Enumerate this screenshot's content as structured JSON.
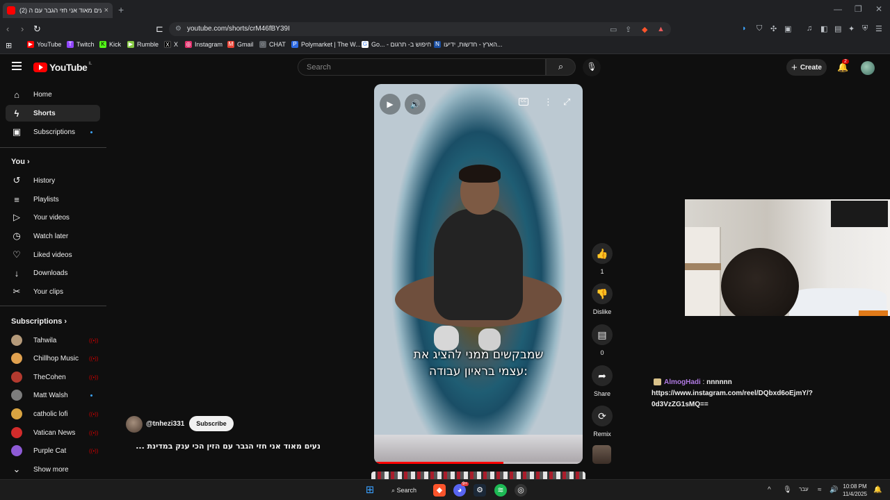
{
  "browser": {
    "tab_title": "(2) נעים מאוד אני חזי הגבר עם ה",
    "tab_close": "×",
    "new_tab": "+",
    "url": "youtube.com/shorts/crM46fBY39I",
    "bookmarks": [
      {
        "label": "YouTube",
        "color": "#ff0000",
        "glyph": "▶"
      },
      {
        "label": "Twitch",
        "color": "#9146ff",
        "glyph": "T"
      },
      {
        "label": "Kick",
        "color": "#53fc18",
        "glyph": "K"
      },
      {
        "label": "Rumble",
        "color": "#85c742",
        "glyph": "▶"
      },
      {
        "label": "X",
        "color": "#000000",
        "glyph": "X"
      },
      {
        "label": "Instagram",
        "color": "#e1306c",
        "glyph": "◎"
      },
      {
        "label": "Gmail",
        "color": "#ea4335",
        "glyph": "M"
      },
      {
        "label": "CHAT",
        "color": "#5f6368",
        "glyph": "◌"
      },
      {
        "label": "Polymarket | The W...",
        "color": "#2d6ae3",
        "glyph": "P"
      },
      {
        "label": "Go... - חיפוש ב- תרגום",
        "color": "#ffffff",
        "glyph": "G"
      },
      {
        "label": "הארץ - חדשות, ידיעו...",
        "color": "#1a4fa3",
        "glyph": "N"
      }
    ]
  },
  "youtube": {
    "logo_text": "YouTube",
    "logo_country": "IL",
    "search_placeholder": "Search",
    "create_label": "Create",
    "notif_count": "2"
  },
  "sidebar": {
    "main": [
      {
        "label": "Home",
        "icon": "home-icon",
        "glyph": "⌂"
      },
      {
        "label": "Shorts",
        "icon": "shorts-icon",
        "glyph": "ϟ"
      },
      {
        "label": "Subscriptions",
        "icon": "subscriptions-icon",
        "glyph": "▣"
      }
    ],
    "you_heading": "You",
    "you_items": [
      {
        "label": "History",
        "icon": "history-icon",
        "glyph": "↺"
      },
      {
        "label": "Playlists",
        "icon": "playlists-icon",
        "glyph": "≡"
      },
      {
        "label": "Your videos",
        "icon": "your-videos-icon",
        "glyph": "▷"
      },
      {
        "label": "Watch later",
        "icon": "watch-later-icon",
        "glyph": "◷"
      },
      {
        "label": "Liked videos",
        "icon": "liked-videos-icon",
        "glyph": "👍"
      },
      {
        "label": "Downloads",
        "icon": "downloads-icon",
        "glyph": "↓"
      },
      {
        "label": "Your clips",
        "icon": "clips-icon",
        "glyph": "✂"
      }
    ],
    "subs_heading": "Subscriptions",
    "subscriptions": [
      {
        "label": "Tahwila",
        "color": "#b59a7a",
        "status": "live"
      },
      {
        "label": "Chillhop Music",
        "color": "#e0a14f",
        "status": "live"
      },
      {
        "label": "TheCohen",
        "color": "#b33a2f",
        "status": "live"
      },
      {
        "label": "Matt Walsh",
        "color": "#7d7d7d",
        "status": "dot"
      },
      {
        "label": "catholic lofi",
        "color": "#d9a441",
        "status": "live"
      },
      {
        "label": "Vatican News",
        "color": "#d22b2b",
        "status": "live"
      },
      {
        "label": "Purple Cat",
        "color": "#8e5bd6",
        "status": "live"
      }
    ],
    "show_more": "Show more"
  },
  "player": {
    "caption_line1": "שמבקשים ממני להציג את",
    "caption_line2": "עצמי בראיון עבודה:",
    "progress": 0.62
  },
  "actions": {
    "like_count": "1",
    "dislike_label": "Dislike",
    "comments_count": "0",
    "share_label": "Share",
    "remix_label": "Remix"
  },
  "channel": {
    "handle": "@tnhezi331",
    "subscribe_label": "Subscribe",
    "video_title": "נעים מאוד אני חזי הגבר עם הזין הכי ענק במדינת ..."
  },
  "chat": {
    "user": "AlmogHadi",
    "sep": " : ",
    "message": "nnnnnn",
    "link": "https://www.instagram.com/reel/DQbxd6oEjmY/?0d3VzZG1sMQ=="
  },
  "taskbar": {
    "search_label": "Search",
    "discord_badge": "9+",
    "lang": "עבר",
    "time": "10:08 PM",
    "date": "11/4/2025"
  }
}
